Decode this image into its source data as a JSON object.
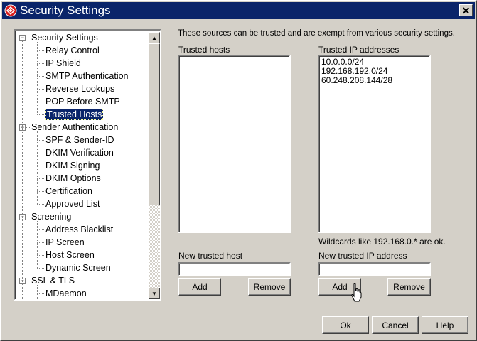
{
  "window": {
    "title": "Security Settings",
    "close_glyph": "✕",
    "icon": "shield-app-icon"
  },
  "tree": {
    "items": [
      {
        "label": "Security Settings",
        "level": 0,
        "expander": "⊟"
      },
      {
        "label": "Relay Control",
        "level": 1
      },
      {
        "label": "IP Shield",
        "level": 1
      },
      {
        "label": "SMTP Authentication",
        "level": 1
      },
      {
        "label": "Reverse Lookups",
        "level": 1
      },
      {
        "label": "POP Before SMTP",
        "level": 1
      },
      {
        "label": "Trusted Hosts",
        "level": 1,
        "selected": true
      },
      {
        "label": "Sender Authentication",
        "level": 0,
        "expander": "⊟"
      },
      {
        "label": "SPF & Sender-ID",
        "level": 1
      },
      {
        "label": "DKIM Verification",
        "level": 1
      },
      {
        "label": "DKIM Signing",
        "level": 1
      },
      {
        "label": "DKIM Options",
        "level": 1
      },
      {
        "label": "Certification",
        "level": 1
      },
      {
        "label": "Approved List",
        "level": 1
      },
      {
        "label": "Screening",
        "level": 0,
        "expander": "⊟"
      },
      {
        "label": "Address Blacklist",
        "level": 1
      },
      {
        "label": "IP Screen",
        "level": 1
      },
      {
        "label": "Host Screen",
        "level": 1
      },
      {
        "label": "Dynamic Screen",
        "level": 1
      },
      {
        "label": "SSL & TLS",
        "level": 0,
        "expander": "⊟"
      },
      {
        "label": "MDaemon",
        "level": 1
      }
    ],
    "scroll_up_glyph": "▲",
    "scroll_down_glyph": "▼"
  },
  "main": {
    "description": "These sources can be trusted and are exempt from various security settings.",
    "hosts": {
      "label": "Trusted hosts",
      "entries": [],
      "new_label": "New trusted host",
      "new_value": "",
      "add_label": "Add",
      "remove_label": "Remove"
    },
    "ips": {
      "label": "Trusted IP addresses",
      "entries": [
        "10.0.0.0/24",
        "192.168.192.0/24",
        "60.248.208.144/28"
      ],
      "wildcard_note": "Wildcards like 192.168.0.* are ok.",
      "new_label": "New trusted IP address",
      "new_value": "",
      "add_label": "Add",
      "remove_label": "Remove"
    }
  },
  "footer": {
    "ok_label": "Ok",
    "cancel_label": "Cancel",
    "help_label": "Help"
  },
  "colors": {
    "titlebar": "#0a246a",
    "selection": "#0a246a",
    "face": "#d4d0c8"
  }
}
